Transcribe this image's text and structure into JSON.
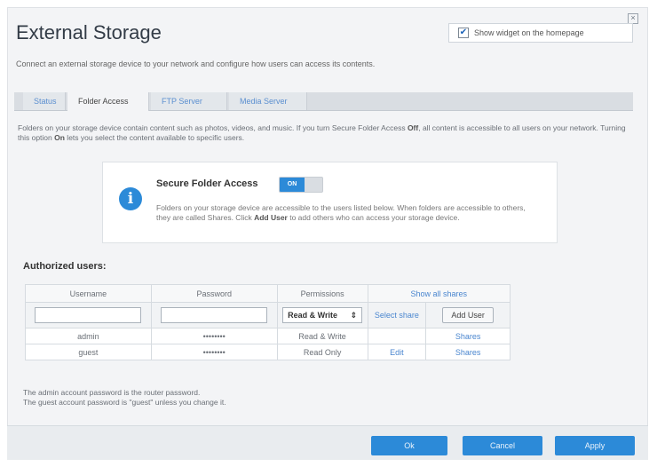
{
  "page": {
    "title": "External Storage",
    "subtitle": "Connect an external storage device to your network and configure how users can access its contents.",
    "close_glyph": "×",
    "show_widget_label": "Show widget on the homepage",
    "show_widget_checked": true
  },
  "tabs": [
    {
      "label": "Status",
      "active": false
    },
    {
      "label": "Folder Access",
      "active": true
    },
    {
      "label": "FTP Server",
      "active": false
    },
    {
      "label": "Media Server",
      "active": false
    }
  ],
  "intro": {
    "part1": "Folders on your storage device contain content such as photos, videos, and music. If you turn Secure Folder Access ",
    "bold1": "Off",
    "part2": ", all content is accessible to all users on your network. Turning this option ",
    "bold2": "On",
    "part3": " lets you select the content available to specific users."
  },
  "secure_card": {
    "label": "Secure Folder Access",
    "toggle_text": "ON",
    "toggle_on": true,
    "desc1": "Folders on your storage device are accessible to the users listed below. When folders are accessible to others, they are called Shares. Click ",
    "desc_bold": "Add User",
    "desc2": " to add others who can access your storage device."
  },
  "users": {
    "heading": "Authorized users:",
    "headers": {
      "username": "Username",
      "password": "Password",
      "permissions": "Permissions",
      "show_all": "Show all shares"
    },
    "new_row": {
      "permission_value": "Read & Write",
      "select_share": "Select share",
      "add_user": "Add User"
    },
    "rows": [
      {
        "username": "admin",
        "password": "••••••••",
        "permission": "Read & Write",
        "edit": "",
        "shares": "Shares"
      },
      {
        "username": "guest",
        "password": "••••••••",
        "permission": "Read Only",
        "edit": "Edit",
        "shares": "Shares"
      }
    ]
  },
  "notes": {
    "line1": "The admin account password is the router password.",
    "line2": "The guest account password is \"guest\" unless you change it."
  },
  "footer": {
    "ok": "Ok",
    "cancel": "Cancel",
    "apply": "Apply"
  },
  "colors": {
    "accent": "#2c8ad8",
    "link": "#4a86cf"
  }
}
